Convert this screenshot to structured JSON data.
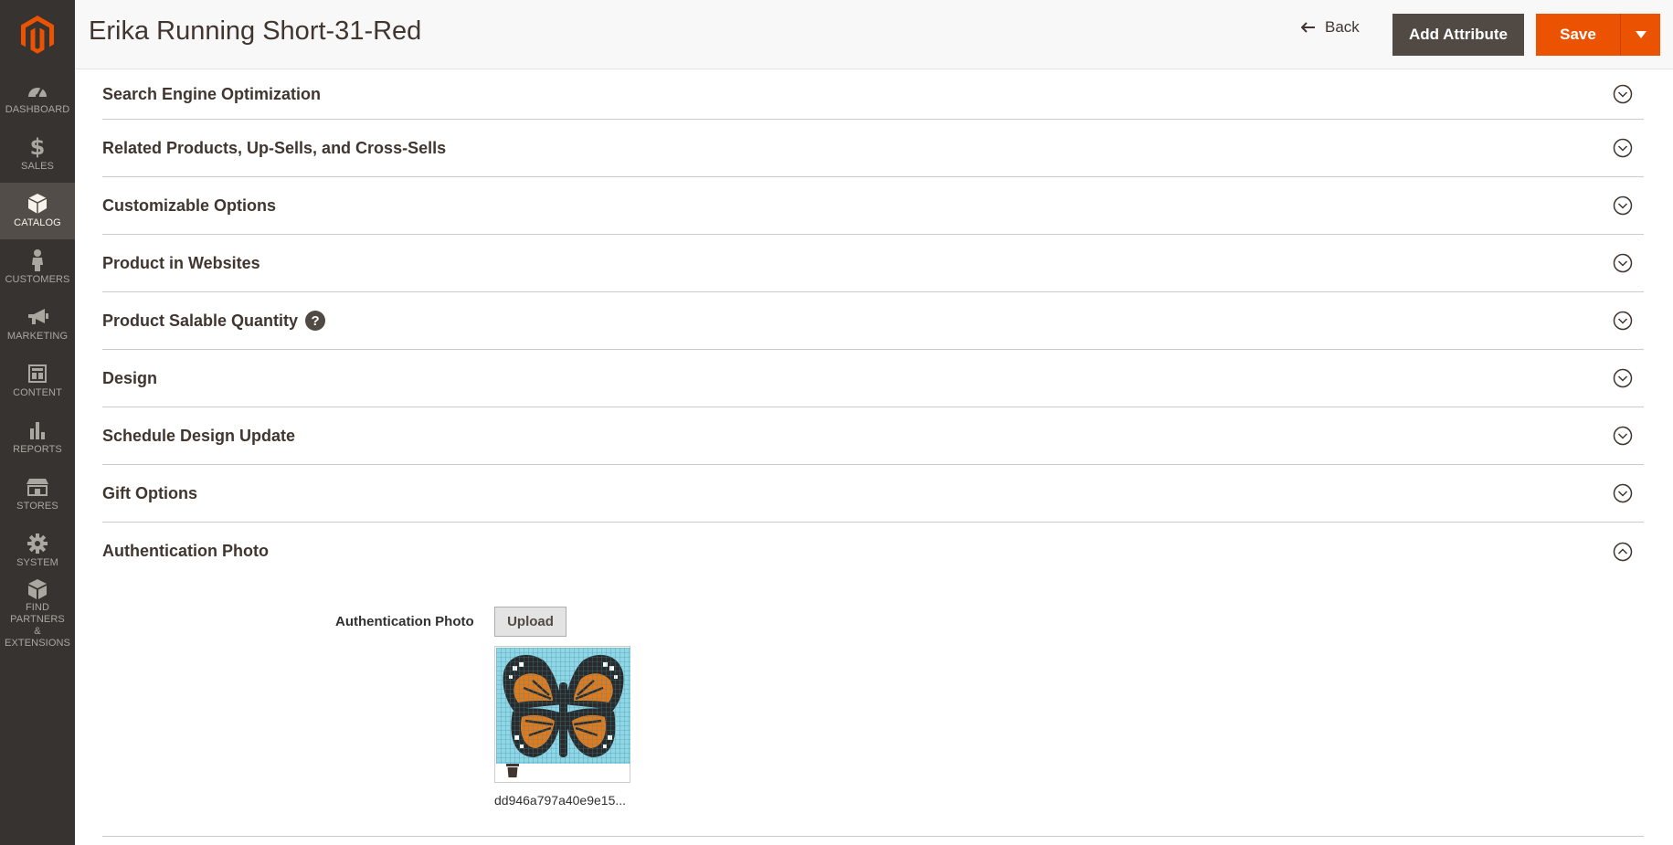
{
  "sidebar": {
    "items": [
      {
        "label": "DASHBOARD",
        "icon": "dashboard-icon"
      },
      {
        "label": "SALES",
        "icon": "dollar-icon"
      },
      {
        "label": "CATALOG",
        "icon": "box-icon"
      },
      {
        "label": "CUSTOMERS",
        "icon": "person-icon"
      },
      {
        "label": "MARKETING",
        "icon": "megaphone-icon"
      },
      {
        "label": "CONTENT",
        "icon": "layout-icon"
      },
      {
        "label": "REPORTS",
        "icon": "bar-chart-icon"
      },
      {
        "label": "STORES",
        "icon": "store-icon"
      },
      {
        "label": "SYSTEM",
        "icon": "gear-icon"
      },
      {
        "label_line1": "FIND PARTNERS",
        "label_line2": "& EXTENSIONS",
        "icon": "cubes-icon"
      }
    ],
    "active": "CATALOG"
  },
  "header": {
    "title": "Erika Running Short-31-Red",
    "back_label": "Back",
    "add_attribute_label": "Add Attribute",
    "save_label": "Save"
  },
  "sections": [
    {
      "title": "Search Engine Optimization",
      "expanded": false
    },
    {
      "title": "Related Products, Up-Sells, and Cross-Sells",
      "expanded": false
    },
    {
      "title": "Customizable Options",
      "expanded": false
    },
    {
      "title": "Product in Websites",
      "expanded": false
    },
    {
      "title": "Product Salable Quantity",
      "expanded": false,
      "help": "?"
    },
    {
      "title": "Design",
      "expanded": false
    },
    {
      "title": "Schedule Design Update",
      "expanded": false
    },
    {
      "title": "Gift Options",
      "expanded": false
    },
    {
      "title": "Authentication Photo",
      "expanded": true
    }
  ],
  "auth_photo": {
    "field_label": "Authentication Photo",
    "upload_label": "Upload",
    "file_name": "dd946a797a40e9e15..."
  },
  "colors": {
    "accent": "#eb5202",
    "sidebar_bg": "#373330",
    "sidebar_active": "#524d49",
    "dark_button": "#514943"
  }
}
